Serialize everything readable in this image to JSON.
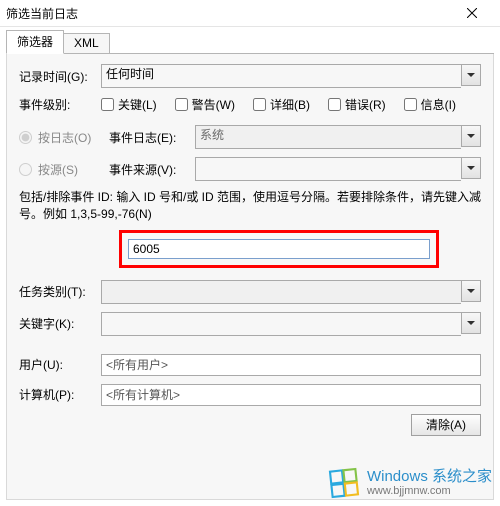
{
  "title": "筛选当前日志",
  "tabs": {
    "filter": "筛选器",
    "xml": "XML"
  },
  "logged_label": "记录时间(G):",
  "logged_value": "任何时间",
  "level_label": "事件级别:",
  "level_options": {
    "critical": "关键(L)",
    "warning": "警告(W)",
    "verbose": "详细(B)",
    "error": "错误(R)",
    "information": "信息(I)"
  },
  "by_log": "按日志(O)",
  "by_source": "按源(S)",
  "event_logs_label": "事件日志(E):",
  "event_logs_value": "系统",
  "event_sources_label": "事件来源(V):",
  "event_sources_value": "",
  "id_desc": "包括/排除事件 ID: 输入 ID 号和/或 ID 范围，使用逗号分隔。若要排除条件，请先键入减号。例如 1,3,5-99,-76(N)",
  "id_value": "6005",
  "task_label": "任务类别(T):",
  "keywords_label": "关键字(K):",
  "user_label": "用户(U):",
  "user_value": "<所有用户>",
  "computer_label": "计算机(P):",
  "computer_value": "<所有计算机>",
  "clear_label": "清除(A)",
  "watermark": {
    "line1": "Windows 系统之家",
    "line2": "www.bjjmnw.com"
  }
}
